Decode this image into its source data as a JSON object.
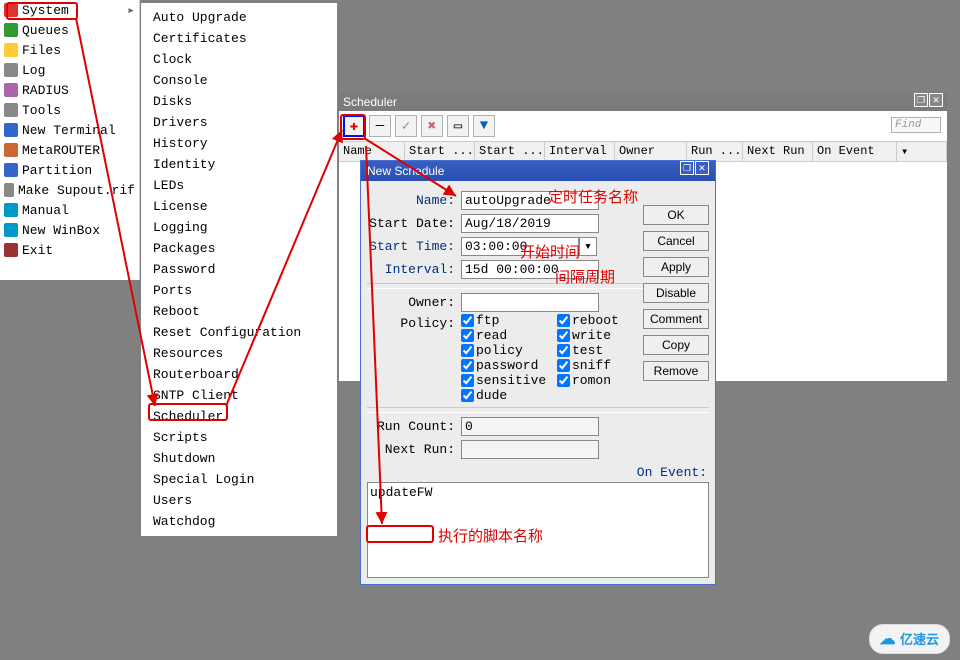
{
  "leftMenu": {
    "items": [
      {
        "label": "System",
        "icon": "gear"
      },
      {
        "label": "Queues",
        "icon": "tree"
      },
      {
        "label": "Files",
        "icon": "folder"
      },
      {
        "label": "Log",
        "icon": "doc"
      },
      {
        "label": "RADIUS",
        "icon": "radius"
      },
      {
        "label": "Tools",
        "icon": "tools"
      },
      {
        "label": "New Terminal",
        "icon": "term"
      },
      {
        "label": "MetaROUTER",
        "icon": "meta"
      },
      {
        "label": "Partition",
        "icon": "pie"
      },
      {
        "label": "Make Supout.rif",
        "icon": "supout"
      },
      {
        "label": "Manual",
        "icon": "help"
      },
      {
        "label": "New WinBox",
        "icon": "winbox"
      },
      {
        "label": "Exit",
        "icon": "exit"
      }
    ]
  },
  "systemMenu": {
    "items": [
      "Auto Upgrade",
      "Certificates",
      "Clock",
      "Console",
      "Disks",
      "Drivers",
      "History",
      "Identity",
      "LEDs",
      "License",
      "Logging",
      "Packages",
      "Password",
      "Ports",
      "Reboot",
      "Reset Configuration",
      "Resources",
      "Routerboard",
      "SNTP Client",
      "Scheduler",
      "Scripts",
      "Shutdown",
      "Special Login",
      "Users",
      "Watchdog"
    ]
  },
  "schedulerWin": {
    "title": "Scheduler",
    "findPlaceholder": "Find",
    "columns": [
      "Name",
      "Start ...",
      "Start ...",
      "Interval",
      "Owner",
      "Run ...",
      "Next Run",
      "On Event"
    ]
  },
  "newSchedule": {
    "title": "New Schedule",
    "labels": {
      "name": "Name:",
      "startDate": "Start Date:",
      "startTime": "Start Time:",
      "interval": "Interval:",
      "owner": "Owner:",
      "policy": "Policy:",
      "runCount": "Run Count:",
      "nextRun": "Next Run:",
      "onEvent": "On Event:"
    },
    "values": {
      "name": "autoUpgrade",
      "startDate": "Aug/18/2019",
      "startTime": "03:00:00",
      "interval": "15d 00:00:00",
      "owner": "",
      "runCount": "0",
      "nextRun": "",
      "script": "updateFW"
    },
    "policies": [
      {
        "label": "ftp",
        "checked": true
      },
      {
        "label": "reboot",
        "checked": true
      },
      {
        "label": "read",
        "checked": true
      },
      {
        "label": "write",
        "checked": true
      },
      {
        "label": "policy",
        "checked": true
      },
      {
        "label": "test",
        "checked": true
      },
      {
        "label": "password",
        "checked": true
      },
      {
        "label": "sniff",
        "checked": true
      },
      {
        "label": "sensitive",
        "checked": true
      },
      {
        "label": "romon",
        "checked": true
      },
      {
        "label": "dude",
        "checked": true
      }
    ],
    "buttons": {
      "ok": "OK",
      "cancel": "Cancel",
      "apply": "Apply",
      "disable": "Disable",
      "comment": "Comment",
      "copy": "Copy",
      "remove": "Remove"
    }
  },
  "annotations": {
    "taskName": "定时任务名称",
    "startTime": "开始时间",
    "intervalPeriod": "间隔周期",
    "scriptName": "执行的脚本名称"
  },
  "watermark": "亿速云"
}
